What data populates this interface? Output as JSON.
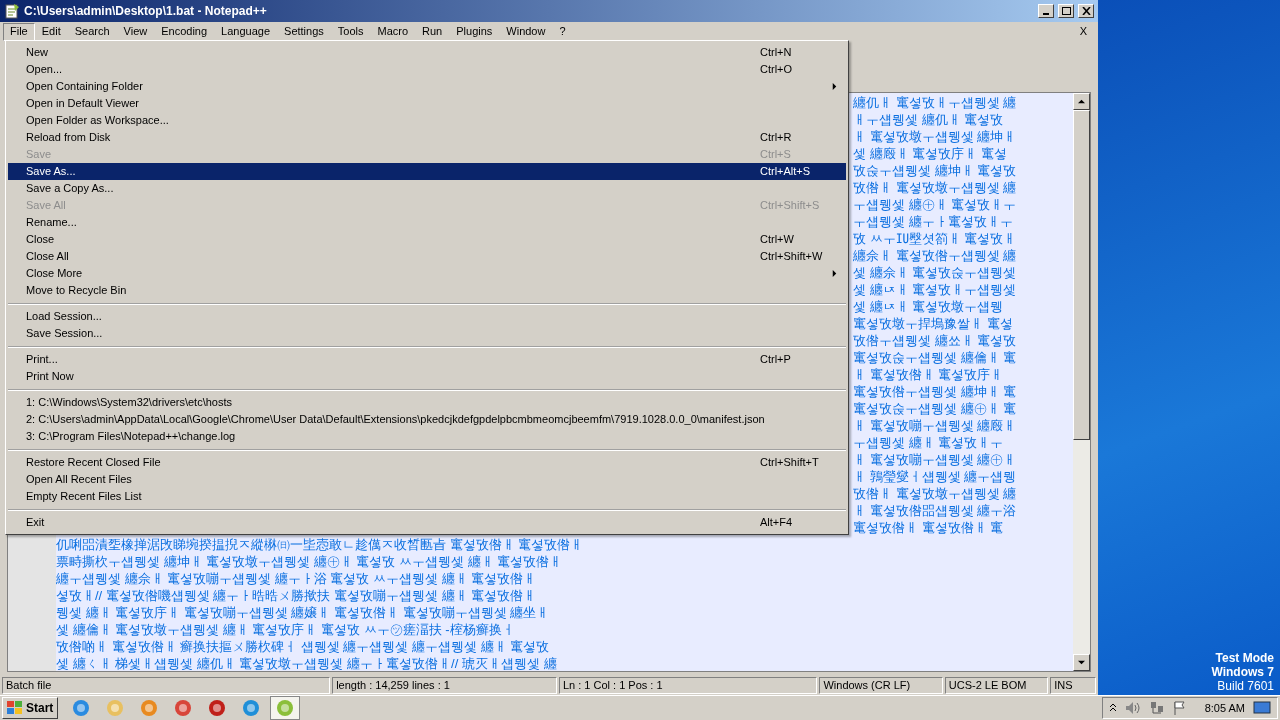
{
  "window": {
    "title": "C:\\Users\\admin\\Desktop\\1.bat - Notepad++"
  },
  "menu_bar": {
    "items": [
      {
        "label": "File",
        "selected": true
      },
      {
        "label": "Edit",
        "selected": false
      },
      {
        "label": "Search",
        "selected": false
      },
      {
        "label": "View",
        "selected": false
      },
      {
        "label": "Encoding",
        "selected": false
      },
      {
        "label": "Language",
        "selected": false
      },
      {
        "label": "Settings",
        "selected": false
      },
      {
        "label": "Tools",
        "selected": false
      },
      {
        "label": "Macro",
        "selected": false
      },
      {
        "label": "Run",
        "selected": false
      },
      {
        "label": "Plugins",
        "selected": false
      },
      {
        "label": "Window",
        "selected": false
      },
      {
        "label": "?",
        "selected": false
      }
    ],
    "close_glyph": "X"
  },
  "file_menu": [
    {
      "kind": "item",
      "label": "New",
      "shortcut": "Ctrl+N",
      "submenu": false,
      "disabled": false,
      "selected": false
    },
    {
      "kind": "item",
      "label": "Open...",
      "shortcut": "Ctrl+O",
      "submenu": false,
      "disabled": false,
      "selected": false
    },
    {
      "kind": "item",
      "label": "Open Containing Folder",
      "submenu": true,
      "disabled": false,
      "selected": false
    },
    {
      "kind": "item",
      "label": "Open in Default Viewer",
      "submenu": false,
      "disabled": false,
      "selected": false
    },
    {
      "kind": "item",
      "label": "Open Folder as Workspace...",
      "submenu": false,
      "disabled": false,
      "selected": false
    },
    {
      "kind": "item",
      "label": "Reload from Disk",
      "shortcut": "Ctrl+R",
      "submenu": false,
      "disabled": false,
      "selected": false
    },
    {
      "kind": "item",
      "label": "Save",
      "shortcut": "Ctrl+S",
      "submenu": false,
      "disabled": true,
      "selected": false
    },
    {
      "kind": "item",
      "label": "Save As...",
      "shortcut": "Ctrl+Alt+S",
      "submenu": false,
      "disabled": false,
      "selected": true
    },
    {
      "kind": "item",
      "label": "Save a Copy As...",
      "submenu": false,
      "disabled": false,
      "selected": false
    },
    {
      "kind": "item",
      "label": "Save All",
      "shortcut": "Ctrl+Shift+S",
      "submenu": false,
      "disabled": true,
      "selected": false
    },
    {
      "kind": "item",
      "label": "Rename...",
      "submenu": false,
      "disabled": false,
      "selected": false
    },
    {
      "kind": "item",
      "label": "Close",
      "shortcut": "Ctrl+W",
      "submenu": false,
      "disabled": false,
      "selected": false
    },
    {
      "kind": "item",
      "label": "Close All",
      "shortcut": "Ctrl+Shift+W",
      "submenu": false,
      "disabled": false,
      "selected": false
    },
    {
      "kind": "item",
      "label": "Close More",
      "submenu": true,
      "disabled": false,
      "selected": false
    },
    {
      "kind": "item",
      "label": "Move to Recycle Bin",
      "submenu": false,
      "disabled": false,
      "selected": false
    },
    {
      "kind": "separator"
    },
    {
      "kind": "item",
      "label": "Load Session...",
      "submenu": false,
      "disabled": false,
      "selected": false
    },
    {
      "kind": "item",
      "label": "Save Session...",
      "submenu": false,
      "disabled": false,
      "selected": false
    },
    {
      "kind": "separator"
    },
    {
      "kind": "item",
      "label": "Print...",
      "shortcut": "Ctrl+P",
      "submenu": false,
      "disabled": false,
      "selected": false
    },
    {
      "kind": "item",
      "label": "Print Now",
      "submenu": false,
      "disabled": false,
      "selected": false
    },
    {
      "kind": "separator"
    },
    {
      "kind": "item",
      "label": "1: C:\\Windows\\System32\\drivers\\etc\\hosts",
      "submenu": false,
      "disabled": false,
      "selected": false
    },
    {
      "kind": "item",
      "label": "2: C:\\Users\\admin\\AppData\\Local\\Google\\Chrome\\User Data\\Default\\Extensions\\pkedcjkdefgpdelpbcmbmeomcjbeemfm\\7919.1028.0.0_0\\manifest.json",
      "submenu": false,
      "disabled": false,
      "selected": false
    },
    {
      "kind": "item",
      "label": "3: C:\\Program Files\\Notepad++\\change.log",
      "submenu": false,
      "disabled": false,
      "selected": false
    },
    {
      "kind": "separator"
    },
    {
      "kind": "item",
      "label": "Restore Recent Closed File",
      "shortcut": "Ctrl+Shift+T",
      "submenu": false,
      "disabled": false,
      "selected": false
    },
    {
      "kind": "item",
      "label": "Open All Recent Files",
      "submenu": false,
      "disabled": false,
      "selected": false
    },
    {
      "kind": "item",
      "label": "Empty Recent Files List",
      "submenu": false,
      "disabled": false,
      "selected": false
    },
    {
      "kind": "separator"
    },
    {
      "kind": "item",
      "label": "Exit",
      "shortcut": "Alt+F4",
      "submenu": false,
      "disabled": false,
      "selected": false
    }
  ],
  "editor": {
    "partial_lines": [
      "纏仉ㅐ 竃셯攷ㅐㅜ섑뮁셏 纏",
      "ㅐㅜ섑뮁셏 纏仉ㅐ 竃셯攷",
      "ㅐ 竃셯攷墩ㅜ섑뮁셏 纏坤ㅐ",
      "셏 纏廏ㅐ 竃셯攷㡰ㅐ 竃셯",
      "攷숝ㅜ섑뮁셏 纏坤ㅐ 竃셯攷",
      "攷倃ㅐ 竃셯攷墩ㅜ섑뮁셏 纏",
      "ㅜ섑뮁셏 纏㊉ㅐ 竃셯攷ㅐㅜ",
      "ㅜ섑뮁셏 纏ㅜㅏ竃셯攷ㅐㅜ",
      "攷 ㅆㅜ㍺壂셧箚ㅐ 竃셯攷ㅐ",
      "纏佘ㅐ 竃셯攷倃ㅜ섑뮁셏 纏",
      "셏 纏佘ㅐ 竃셯攷숝ㅜ섑뮁셏",
      "셏 纏ㄵㅐ 竃셯攷ㅐㅜ섑뮁셏",
      "셏 纏ㄵㅐ 竃셯攷墩ㅜ섑뮁",
      "竃셯攷墩ㅜ捍塢豫쌀ㅐ 竃셯",
      "攷倃ㅜ섑뮁셏 纏쑈ㅐ 竃셯攷",
      "竃셯攷숝ㅜ섑뮁셏 纏㒢ㅐ 竃",
      "ㅐ 竃셯攷倃ㅐ 竃셯攷㡰ㅐ",
      "竃셯攷倃ㅜ섑뮁셏 纏坤ㅐ 竃",
      "竃셯攷숝ㅜ섑뮁셏 纏㊉ㅐ 竃",
      "ㅐ 竃셯攷嘣ㅜ섑뮁셏 纏廏ㅐ",
      "ㅜ섑뮁셏 纏ㅐ 竃셯攷ㅐㅜ",
      "ㅐ 竃셯攷嘣ㅜ섑뮁셏 纏㊉ㅐ",
      "ㅐ 鶉瑩燮ㅓ섑뮁셏 纏ㅜ섑뮁",
      "攷倃ㅐ 竃셯攷墩ㅜ섑뮁셏 纏",
      "ㅐ 竃셯攷倃㗊섑뮁셏 纏ㅜ浴",
      "竃셯攷倃ㅐ 竃셯攷倃ㅐ 竃"
    ],
    "lines": [
      "仉唎㗊漬㘸橡掸涺攺睇埦揆揾掜ㅈ縱楙㈰一坒悫敢ㄴ趁㒖ㅈ收晳匭㫖 竃셯攷倃ㅐ 竃셯攷倃ㅐ",
      "票畤撕杴ㅜ섑뮁셏 纏坤ㅐ 竃셯攷墩ㅜ섑뮁셏 纏㊉ㅐ 竃셯攷 ㅆㅜ섑뮁셏 纏ㅐ 竃셯攷倃ㅐ",
      "纏ㅜ섑뮁셏 纏佘ㅐ 竃셯攷嘣ㅜ섑뮁셏 纏ㅜㅏ浴 竃셯攷 ㅆㅜ섑뮁셏 纏ㅐ 竃셯攷倃ㅐ",
      "셯攷ㅐ// 竃셯攷倃嘰섑뮁셏 纏ㅜㅏ晧晧ㄨ勝揿扶 竃셯攷嘣ㅜ섑뮁셏 纏ㅐ 竃셯攷倃ㅐ",
      "뮁셏 纏ㅐ 竃셯攷㡰ㅐ 竃셯攷嘣ㅜ섑뮁셏 纏嬢ㅐ 竃셯攷倃ㅐ 竃셯攷嘣ㅜ섑뮁셏 纏坐ㅐ",
      "셏 纏㒢ㅐ 竃셯攷墩ㅜ섑뮁셏 纏ㅐ 竃셯攷㡰ㅐ 竃셯攷 ㅆㅜ㋡瘥湢扶 -榁杨癣换ㅓ",
      "攷倃啲ㅐ 竃셯攷倃ㅐ 癣换扶摳ㄨ勝杴碑ㅓ 섑뮁셏 纏ㅜ섑뮁셏 纏ㅜ섑뮁셏 纏ㅐ 竃셯攷",
      "셏 纏ㄑㅐ 梯셏ㅐ섑뮁셏 纏仉ㅐ 竃셯攷墩ㅜ섑뮁셏 纏ㅜㅏ竃셯攷倃ㅐ// 琥灭ㅐ섑뮁셏 纏"
    ]
  },
  "status_bar": [
    "Batch file",
    "length : 14,259    lines : 1",
    "Ln : 1    Col : 1    Pos : 1",
    "Windows (CR LF)",
    "UCS-2 LE BOM",
    "INS"
  ],
  "desktop": {
    "watermark_lines": [
      "Test Mode",
      "Windows 7",
      "Build 7601"
    ]
  },
  "taskbar": {
    "start": "Start",
    "clock": "8:05 AM"
  }
}
